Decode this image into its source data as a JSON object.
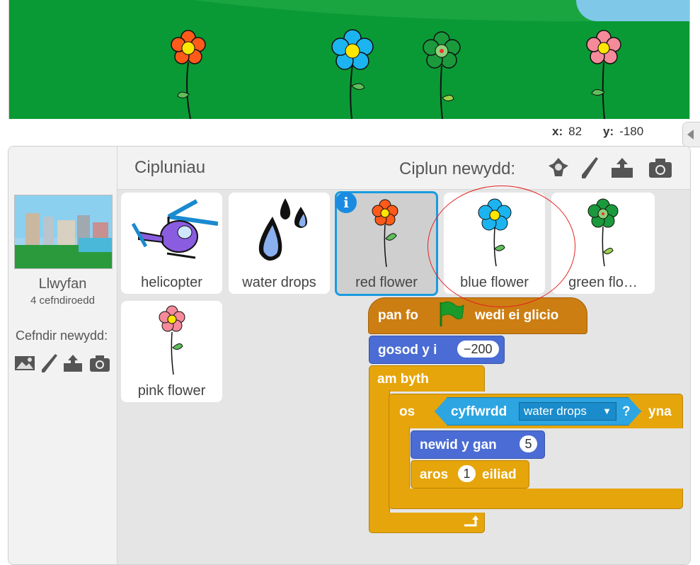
{
  "stage": {
    "coords": {
      "x_label": "x:",
      "x_value": "82",
      "y_label": "y:",
      "y_value": "-180"
    }
  },
  "sprites_pane": {
    "title": "Cipluniau",
    "new_sprite_label": "Ciplun newydd:",
    "new_sprite_icons": [
      "choose-sprite-icon",
      "paint-brush-icon",
      "upload-icon",
      "camera-icon"
    ]
  },
  "stage_col": {
    "name": "Llwyfan",
    "backdrop_count": "4 cefndiroedd",
    "new_backdrop_label": "Cefndir newydd:",
    "new_backdrop_icons": [
      "image-library-icon",
      "paint-brush-icon",
      "upload-icon",
      "camera-icon"
    ]
  },
  "sprites": [
    {
      "label": "helicopter",
      "selected": false
    },
    {
      "label": "water drops",
      "selected": false
    },
    {
      "label": "red flower",
      "selected": true
    },
    {
      "label": "blue flower",
      "selected": false
    },
    {
      "label": "green flo…",
      "selected": false
    },
    {
      "label": "pink flower",
      "selected": false
    }
  ],
  "script": {
    "hat": {
      "before": "pan fo",
      "after": "wedi ei glicio"
    },
    "set_x": {
      "label": "gosod y i",
      "value": "−200"
    },
    "forever": {
      "label": "am byth"
    },
    "if": {
      "label": "os",
      "sensing": "cyffwrdd",
      "option": "water drops",
      "q": "?",
      "then": "yna"
    },
    "change_costume": {
      "label": "newid y gan",
      "value": "5"
    },
    "wait": {
      "label": "aros",
      "value": "1",
      "unit": "eiliad"
    }
  },
  "colors": {
    "events": "#cc7e12",
    "control": "#e6a50a",
    "motion": "#4a6cd4",
    "sensing": "#2ca5e2",
    "selection": "#1a9be0",
    "annotation": "#e52222"
  }
}
